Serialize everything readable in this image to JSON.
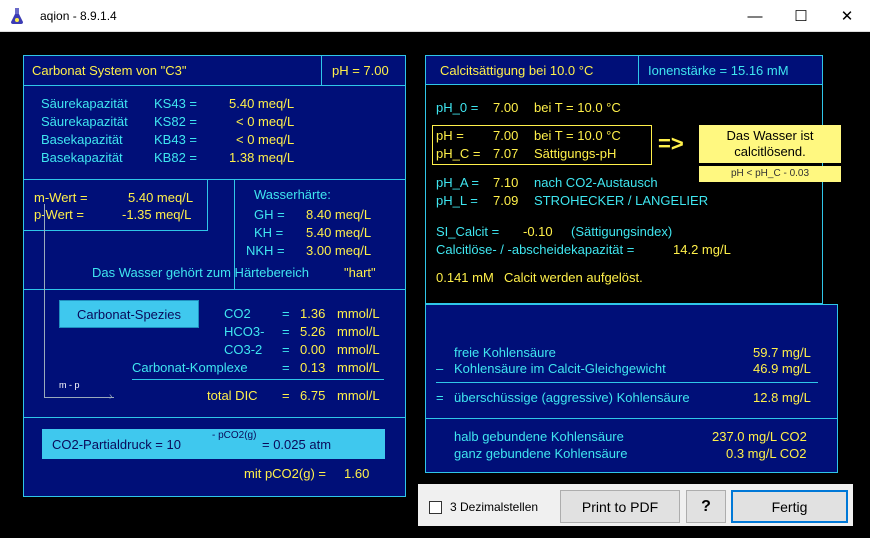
{
  "window": {
    "title": "aqion - 8.9.1.4",
    "minimize": "—",
    "maximize": "☐",
    "close": "✕"
  },
  "carbonat": {
    "title": "Carbonat System von \"C3\"",
    "ph": "pH = 7.00",
    "rows": [
      {
        "label": "Säurekapazität",
        "code": "KS43 =",
        "value": "5.40 meq/L"
      },
      {
        "label": "Säurekapazität",
        "code": "KS82 =",
        "value": "< 0 meq/L"
      },
      {
        "label": "Basekapazität",
        "code": "KB43 =",
        "value": "< 0 meq/L"
      },
      {
        "label": "Basekapazität",
        "code": "KB82 =",
        "value": "1.38 meq/L"
      }
    ],
    "mwert_label": "m-Wert  =",
    "mwert_value": "5.40 meq/L",
    "pwert_label": "p-Wert  =",
    "pwert_value": "-1.35 meq/L",
    "haerte_title": "Wasserhärte:",
    "gh_label": "GH  =",
    "gh_value": "8.40 meq/L",
    "kh_label": "KH  =",
    "kh_value": "5.40 meq/L",
    "nkh_label": "NKH  =",
    "nkh_value": "3.00 meq/L",
    "haerte_text": "Das Wasser gehört zum Härtebereich",
    "haerte_value": "\"hart\"",
    "spezies_button": "Carbonat-Spezies",
    "species": [
      {
        "name": "CO2",
        "eq": "=",
        "value": "1.36",
        "unit": "mmol/L"
      },
      {
        "name": "HCO3-",
        "eq": "=",
        "value": "5.26",
        "unit": "mmol/L"
      },
      {
        "name": "CO3-2",
        "eq": "=",
        "value": "0.00",
        "unit": "mmol/L"
      },
      {
        "name": "Carbonat-Komplexe",
        "eq": "=",
        "value": "0.13",
        "unit": "mmol/L"
      }
    ],
    "dic_label": "total DIC",
    "dic_eq": "=",
    "dic_value": "6.75",
    "dic_unit": "mmol/L",
    "axis_label": "m - p",
    "partial_label": "CO2-Partialdruck  = 10",
    "partial_exp": "- pCO2(g)",
    "partial_value": " = 0.025 atm",
    "pco2_label": "mit  pCO2(g)  =",
    "pco2_value": "1.60"
  },
  "calcit": {
    "title": "Calcitsättigung bei 10.0 °C",
    "ionic": "Ionenstärke = 15.16 mM",
    "ph0_label": "pH_0  = ",
    "ph0_value": "7.00",
    "ph0_desc": "bei T = 10.0 °C",
    "ph_label": "pH     = ",
    "ph_value": "7.00",
    "ph_desc": "bei T = 10.0 °C",
    "phc_label": "pH_C = ",
    "phc_value": "7.07",
    "phc_desc": "Sättigungs-pH",
    "arrow": "=>",
    "verdict_line1": "Das Wasser ist",
    "verdict_line2": "calcitlösend.",
    "verdict_cond": "pH < pH_C - 0.03",
    "pha_label": "pH_A  = ",
    "pha_value": "7.10",
    "pha_desc": "nach CO2-Austausch",
    "phl_label": "pH_L  = ",
    "phl_value": "7.09",
    "phl_desc": "STROHECKER / LANGELIER",
    "si_label": "SI_Calcit =",
    "si_value": "-0.10",
    "si_desc": "(Sättigungsindex)",
    "kap_label": "Calcitlöse- / -abscheidekapazität =",
    "kap_value": "14.2 mg/L",
    "dissolve_value": "0.141 mM",
    "dissolve_text": "Calcit werden aufgelöst."
  },
  "kohlen": {
    "rows": [
      {
        "prefix": "",
        "label": "freie Kohlensäure",
        "value": "59.7 mg/L"
      },
      {
        "prefix": "–",
        "label": "Kohlensäure im Calcit-Gleichgewicht",
        "value": "46.9 mg/L"
      }
    ],
    "result": {
      "prefix": "=",
      "label": "überschüssige (aggressive) Kohlensäure",
      "value": "12.8 mg/L"
    },
    "halb_label": "halb gebundene Kohlensäure",
    "halb_value": "237.0 mg/L CO2",
    "ganz_label": "ganz gebundene Kohlensäure",
    "ganz_value": "0.3 mg/L CO2"
  },
  "footer": {
    "checkbox_label": "3 Dezimalstellen",
    "checkbox_checked": false,
    "print": "Print to PDF",
    "help": "?",
    "done": "Fertig"
  }
}
